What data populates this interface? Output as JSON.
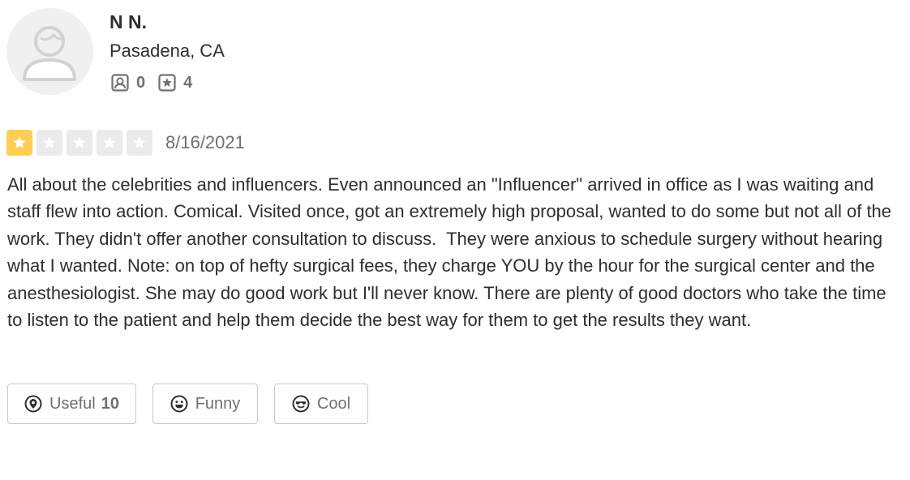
{
  "user": {
    "name": "N N.",
    "location": "Pasadena, CA",
    "friends_count": "0",
    "reviews_count": "4"
  },
  "review": {
    "rating": 1,
    "max_rating": 5,
    "date": "8/16/2021",
    "text": "All about the celebrities and influencers. Even announced an \"Influencer\" arrived in office as I was waiting and staff flew into action. Comical. Visited once, got an extremely high proposal, wanted to do some but not all of the work. They didn't offer another consultation to discuss.  They were anxious to schedule surgery without hearing what I wanted. Note: on top of hefty surgical fees, they charge YOU by the hour for the surgical center and the anesthesiologist. She may do good work but I'll never know. There are plenty of good doctors who take the time to listen to the patient and help them decide the best way for them to get the results they want."
  },
  "reactions": {
    "useful_label": "Useful",
    "useful_count": "10",
    "funny_label": "Funny",
    "cool_label": "Cool"
  },
  "colors": {
    "star_filled": "#ffce52",
    "star_empty": "#ebebeb",
    "text": "#2d2e2f",
    "muted": "#6e7072"
  },
  "icons": {
    "friends": "friends-icon",
    "reviews": "review-star-icon",
    "useful": "useful-pin-icon",
    "funny": "funny-face-icon",
    "cool": "cool-face-icon"
  }
}
